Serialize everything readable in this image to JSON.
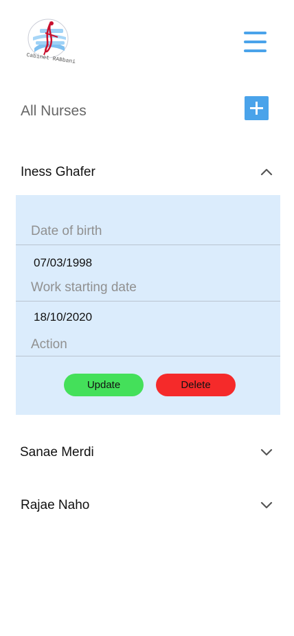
{
  "logo": {
    "text": "Cabinet RABbani"
  },
  "header": {
    "menu_icon": "hamburger-menu-icon"
  },
  "page": {
    "title": "All Nurses",
    "add_icon": "plus-icon"
  },
  "nurses": [
    {
      "name": "Iness Ghafer",
      "expanded": true,
      "details": {
        "dob_label": "Date of birth",
        "dob_value": "07/03/1998",
        "start_label": "Work starting date",
        "start_value": "18/10/2020",
        "action_label": "Action",
        "update_label": "Update",
        "delete_label": "Delete"
      }
    },
    {
      "name": "Sanae Merdi",
      "expanded": false
    },
    {
      "name": "Rajae Naho",
      "expanded": false
    }
  ],
  "colors": {
    "accent": "#4aa3ea",
    "panel_bg": "#dbecfc",
    "update": "#44e05a",
    "delete": "#f52a2a"
  }
}
